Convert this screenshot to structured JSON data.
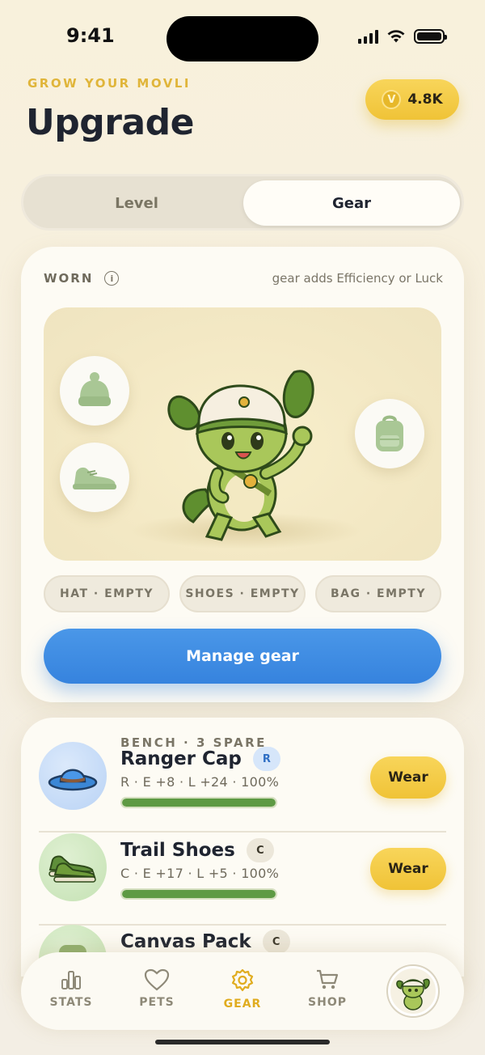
{
  "status": {
    "time": "9:41"
  },
  "header": {
    "eyebrow": "GROW YOUR MOVLI",
    "title": "Upgrade",
    "coins": "4.8K",
    "coin_glyph": "V"
  },
  "tabs": {
    "level": "Level",
    "gear": "Gear",
    "active": "Gear"
  },
  "worn": {
    "label": "WORN",
    "hint": "gear adds Efficiency or Luck",
    "slots": {
      "hat": "HAT · EMPTY",
      "shoes": "SHOES · EMPTY",
      "bag": "BAG · EMPTY"
    },
    "manage_label": "Manage gear"
  },
  "bench": {
    "label": "BENCH · 3 SPARE",
    "items": [
      {
        "name": "Ranger Cap",
        "rarity": "R",
        "stats": "R · E +8 · L +24 · 100%",
        "durability": 100,
        "action": "Wear",
        "icon": "ranger-cap-icon"
      },
      {
        "name": "Trail Shoes",
        "rarity": "C",
        "stats": "C · E +17 · L +5 · 100%",
        "durability": 100,
        "action": "Wear",
        "icon": "trail-shoes-icon"
      },
      {
        "name": "Canvas Pack",
        "rarity": "C",
        "icon": "canvas-pack-icon"
      }
    ]
  },
  "nav": {
    "stats": "STATS",
    "pets": "PETS",
    "gear": "GEAR",
    "shop": "SHOP",
    "active": "GEAR"
  },
  "colors": {
    "accent_gold": "#f0c337",
    "primary_blue": "#3683de",
    "bar_green": "#5e9a44",
    "active_tab": "#e0ac1f"
  }
}
